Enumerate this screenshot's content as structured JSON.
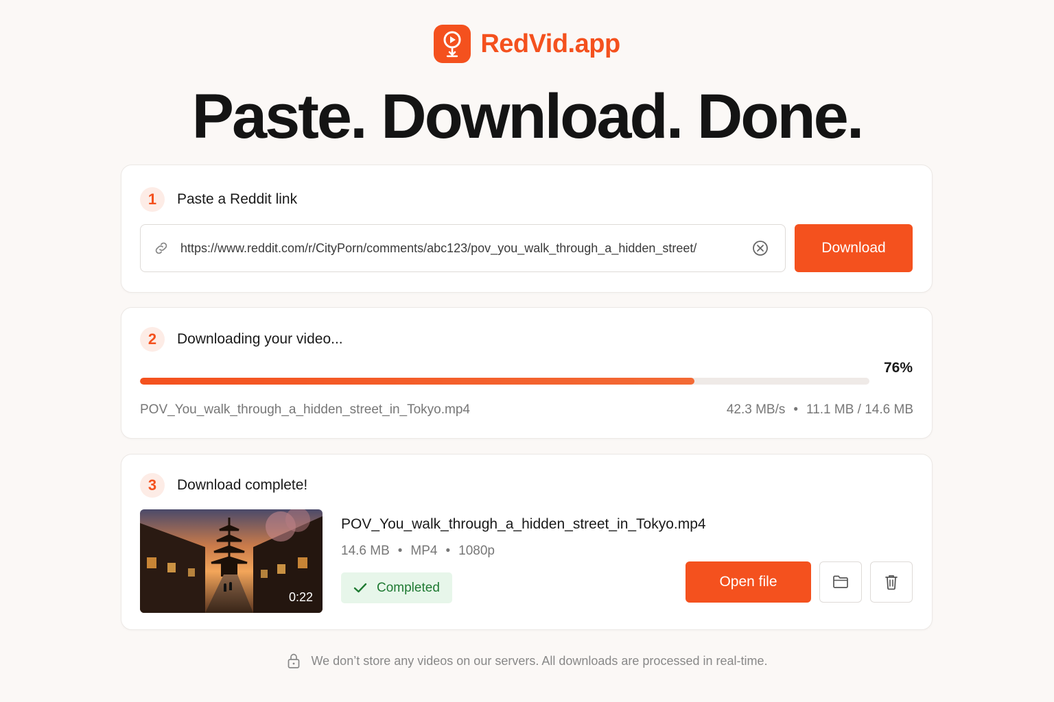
{
  "brand": {
    "name": "RedVid.app",
    "accent": "#f4511e",
    "logo_icon": "play-download-icon"
  },
  "headline": "Paste. Download. Done.",
  "step1": {
    "number": "1",
    "title": "Paste a Reddit link",
    "url_value": "https://www.reddit.com/r/CityPorn/comments/abc123/pov_you_walk_through_a_hidden_street/",
    "download_label": "Download"
  },
  "step2": {
    "number": "2",
    "title": "Downloading your video...",
    "progress_percent": 76,
    "progress_label": "76%",
    "file_name": "POV_You_walk_through_a_hidden_street_in_Tokyo.mp4",
    "speed": "42.3 MB/s",
    "separator": "•",
    "transferred": "11.1 MB / 14.6 MB"
  },
  "step3": {
    "number": "3",
    "title": "Download complete!",
    "file_name": "POV_You_walk_through_a_hidden_street_in_Tokyo.mp4",
    "duration": "0:22",
    "size": "14.6 MB",
    "format": "MP4",
    "resolution": "1080p",
    "separator": "•",
    "status": "Completed",
    "status_color": "#1f7a32",
    "open_label": "Open file"
  },
  "footer": {
    "text": "We don’t store any videos on our servers. All downloads are processed in real-time."
  }
}
